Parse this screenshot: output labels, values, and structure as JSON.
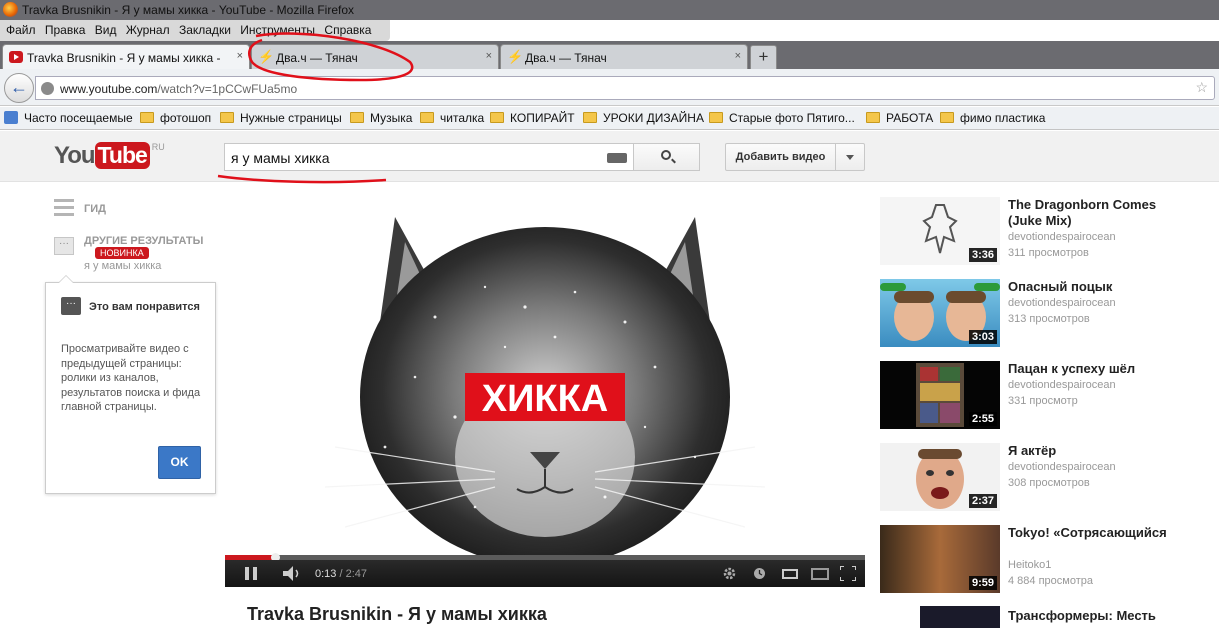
{
  "window": {
    "title": "Travka Brusnikin - Я у мамы хикка - YouTube - Mozilla Firefox"
  },
  "menu": [
    "Файл",
    "Правка",
    "Вид",
    "Журнал",
    "Закладки",
    "Инструменты",
    "Справка"
  ],
  "tabs": [
    {
      "label": "Travka Brusnikin - Я у мамы хикка - ...",
      "close": "×",
      "active": true
    },
    {
      "label": "Два.ч — Тянач",
      "close": "×",
      "active": false
    },
    {
      "label": "Два.ч — Тянач",
      "close": "×",
      "active": false
    }
  ],
  "new_tab": "+",
  "navbar": {
    "back": "←",
    "url_host": "www.youtube.com",
    "url_path": "/watch?v=1pCCwFUa5mo",
    "star": "☆"
  },
  "bookmarks": [
    "Часто посещаемые",
    "фотошоп",
    "Нужные страницы",
    "Музыка",
    "читалка",
    "КОПИРАЙТ",
    "УРОКИ ДИЗАЙНА",
    "Старые фото Пятиго...",
    "РАБОТА",
    "фимо пластика"
  ],
  "youtube": {
    "logo_you": "You",
    "logo_tube": "Tube",
    "logo_region": "RU",
    "search_value": "я у мамы хикка",
    "upload_label": "Добавить видео"
  },
  "guide": {
    "guide_label": "ГИД",
    "other_icon": "···",
    "other_label": "ДРУГИЕ РЕЗУЛЬТАТЫ",
    "new_badge": "НОВИНКА",
    "other_sub": "я у мамы хикка"
  },
  "tip": {
    "icon": "···",
    "title": "Это вам понравится",
    "body": "Просматривайте видео с предыдущей страницы: ролики из каналов, результатов поиска и фида главной страницы.",
    "ok": "OK"
  },
  "player": {
    "overlay_text": "ХИККА",
    "current_time": "0:13",
    "separator": " / ",
    "duration": "2:47",
    "progress_fraction": 0.078
  },
  "video": {
    "title": "Travka Brusnikin - Я у мамы хикка"
  },
  "related": [
    {
      "title": "The Dragonborn Comes (Juke Mix)",
      "author": "devotiondespairocean",
      "views": "311 просмотров",
      "duration": "3:36"
    },
    {
      "title": "Опасный поцык",
      "author": "devotiondespairocean",
      "views": "313 просмотров",
      "duration": "3:03"
    },
    {
      "title": "Пацан к успеху шёл",
      "author": "devotiondespairocean",
      "views": "331 просмотр",
      "duration": "2:55"
    },
    {
      "title": "Я актёр",
      "author": "devotiondespairocean",
      "views": "308 просмотров",
      "duration": "2:37"
    },
    {
      "title": "Tokyo! «Сотрясающийся",
      "author": "Heitoko1",
      "views": "4 884 просмотра",
      "duration": "9:59"
    },
    {
      "title": "Трансформеры: Месть",
      "author": "",
      "views": "",
      "duration": ""
    }
  ],
  "colors": {
    "youtube_red": "#cc181e",
    "ok_blue": "#3b78c7",
    "annotation_red": "#e0101a"
  }
}
